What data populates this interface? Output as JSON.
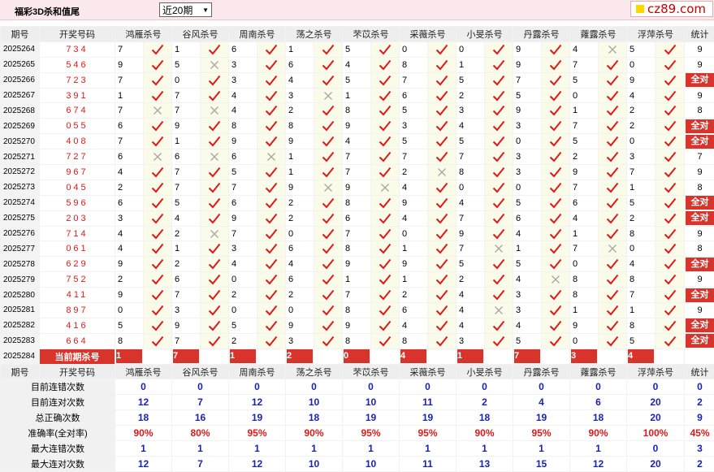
{
  "header": {
    "title": "福彩3D杀和值尾",
    "period_select": "近20期",
    "logo": "cz89.com"
  },
  "columns": [
    "期号",
    "开奖号码",
    "鸿雁杀号",
    "谷风杀号",
    "周南杀号",
    "荡之杀号",
    "芣苡杀号",
    "采薇杀号",
    "小旻杀号",
    "丹露杀号",
    "蕹露杀号",
    "浮萍杀号",
    "统计"
  ],
  "rows": [
    {
      "period": "2025264",
      "draw": "734",
      "nums": [
        "7",
        "1",
        "6",
        "1",
        "5",
        "0",
        "0",
        "9",
        "4",
        "5"
      ],
      "marks": [
        1,
        1,
        1,
        1,
        1,
        1,
        1,
        1,
        0,
        1
      ],
      "total": "9"
    },
    {
      "period": "2025265",
      "draw": "546",
      "nums": [
        "9",
        "5",
        "3",
        "6",
        "4",
        "8",
        "1",
        "9",
        "7",
        "0"
      ],
      "marks": [
        1,
        0,
        1,
        1,
        1,
        1,
        1,
        1,
        1,
        1
      ],
      "total": "9"
    },
    {
      "period": "2025266",
      "draw": "723",
      "nums": [
        "7",
        "0",
        "3",
        "4",
        "5",
        "7",
        "5",
        "7",
        "5",
        "9"
      ],
      "marks": [
        1,
        1,
        1,
        1,
        1,
        1,
        1,
        1,
        1,
        1
      ],
      "total": "全对"
    },
    {
      "period": "2025267",
      "draw": "391",
      "nums": [
        "1",
        "7",
        "4",
        "3",
        "1",
        "6",
        "2",
        "5",
        "0",
        "4"
      ],
      "marks": [
        1,
        1,
        1,
        0,
        1,
        1,
        1,
        1,
        1,
        1
      ],
      "total": "9"
    },
    {
      "period": "2025268",
      "draw": "674",
      "nums": [
        "7",
        "7",
        "4",
        "2",
        "8",
        "5",
        "3",
        "9",
        "1",
        "2"
      ],
      "marks": [
        0,
        0,
        1,
        1,
        1,
        1,
        1,
        1,
        1,
        1
      ],
      "total": "8"
    },
    {
      "period": "2025269",
      "draw": "055",
      "nums": [
        "6",
        "9",
        "8",
        "8",
        "9",
        "3",
        "4",
        "3",
        "7",
        "2"
      ],
      "marks": [
        1,
        1,
        1,
        1,
        1,
        1,
        1,
        1,
        1,
        1
      ],
      "total": "全对"
    },
    {
      "period": "2025270",
      "draw": "408",
      "nums": [
        "7",
        "1",
        "9",
        "9",
        "4",
        "5",
        "5",
        "0",
        "5",
        "0"
      ],
      "marks": [
        1,
        1,
        1,
        1,
        1,
        1,
        1,
        1,
        1,
        1
      ],
      "total": "全对"
    },
    {
      "period": "2025271",
      "draw": "727",
      "nums": [
        "6",
        "6",
        "6",
        "1",
        "7",
        "7",
        "7",
        "3",
        "2",
        "3"
      ],
      "marks": [
        0,
        0,
        0,
        1,
        1,
        1,
        1,
        1,
        1,
        1
      ],
      "total": "7"
    },
    {
      "period": "2025272",
      "draw": "967",
      "nums": [
        "4",
        "7",
        "5",
        "1",
        "7",
        "2",
        "8",
        "3",
        "9",
        "7"
      ],
      "marks": [
        1,
        1,
        1,
        1,
        1,
        0,
        1,
        1,
        1,
        1
      ],
      "total": "9"
    },
    {
      "period": "2025273",
      "draw": "045",
      "nums": [
        "2",
        "7",
        "7",
        "9",
        "9",
        "4",
        "0",
        "0",
        "7",
        "1"
      ],
      "marks": [
        1,
        1,
        1,
        0,
        0,
        1,
        1,
        1,
        1,
        1
      ],
      "total": "8"
    },
    {
      "period": "2025274",
      "draw": "596",
      "nums": [
        "6",
        "5",
        "6",
        "2",
        "8",
        "9",
        "4",
        "5",
        "6",
        "5"
      ],
      "marks": [
        1,
        1,
        1,
        1,
        1,
        1,
        1,
        1,
        1,
        1
      ],
      "total": "全对"
    },
    {
      "period": "2025275",
      "draw": "203",
      "nums": [
        "3",
        "4",
        "9",
        "2",
        "6",
        "4",
        "7",
        "6",
        "4",
        "2"
      ],
      "marks": [
        1,
        1,
        1,
        1,
        1,
        1,
        1,
        1,
        1,
        1
      ],
      "total": "全对"
    },
    {
      "period": "2025276",
      "draw": "714",
      "nums": [
        "4",
        "2",
        "7",
        "0",
        "7",
        "0",
        "9",
        "4",
        "1",
        "8"
      ],
      "marks": [
        1,
        0,
        1,
        1,
        1,
        1,
        1,
        1,
        1,
        1
      ],
      "total": "9"
    },
    {
      "period": "2025277",
      "draw": "061",
      "nums": [
        "4",
        "1",
        "3",
        "6",
        "8",
        "1",
        "7",
        "1",
        "7",
        "0"
      ],
      "marks": [
        1,
        1,
        1,
        1,
        1,
        1,
        0,
        1,
        0,
        1
      ],
      "total": "8"
    },
    {
      "period": "2025278",
      "draw": "629",
      "nums": [
        "9",
        "2",
        "4",
        "4",
        "9",
        "9",
        "5",
        "5",
        "0",
        "4"
      ],
      "marks": [
        1,
        1,
        1,
        1,
        1,
        1,
        1,
        1,
        1,
        1
      ],
      "total": "全对"
    },
    {
      "period": "2025279",
      "draw": "752",
      "nums": [
        "2",
        "6",
        "0",
        "6",
        "1",
        "1",
        "2",
        "4",
        "8",
        "8"
      ],
      "marks": [
        1,
        1,
        1,
        1,
        1,
        1,
        1,
        0,
        1,
        1
      ],
      "total": "9"
    },
    {
      "period": "2025280",
      "draw": "411",
      "nums": [
        "9",
        "7",
        "2",
        "2",
        "7",
        "2",
        "4",
        "3",
        "8",
        "7"
      ],
      "marks": [
        1,
        1,
        1,
        1,
        1,
        1,
        1,
        1,
        1,
        1
      ],
      "total": "全对"
    },
    {
      "period": "2025281",
      "draw": "897",
      "nums": [
        "0",
        "3",
        "0",
        "0",
        "8",
        "6",
        "4",
        "3",
        "1",
        "1"
      ],
      "marks": [
        1,
        1,
        1,
        1,
        1,
        1,
        0,
        1,
        1,
        1
      ],
      "total": "9"
    },
    {
      "period": "2025282",
      "draw": "416",
      "nums": [
        "5",
        "9",
        "5",
        "9",
        "9",
        "4",
        "4",
        "4",
        "9",
        "8"
      ],
      "marks": [
        1,
        1,
        1,
        1,
        1,
        1,
        1,
        1,
        1,
        1
      ],
      "total": "全对"
    },
    {
      "period": "2025283",
      "draw": "664",
      "nums": [
        "8",
        "7",
        "2",
        "3",
        "8",
        "8",
        "3",
        "5",
        "0",
        "5"
      ],
      "marks": [
        1,
        1,
        1,
        1,
        1,
        1,
        1,
        1,
        1,
        1
      ],
      "total": "全对"
    }
  ],
  "current": {
    "period": "2025284",
    "label": "当前期杀号",
    "nums": [
      "1",
      "7",
      "1",
      "2",
      "0",
      "4",
      "1",
      "7",
      "3",
      "4"
    ]
  },
  "stats": [
    {
      "label": "目前连错次数",
      "values": [
        "0",
        "0",
        "0",
        "0",
        "0",
        "0",
        "0",
        "0",
        "0",
        "0",
        "0"
      ]
    },
    {
      "label": "目前连对次数",
      "values": [
        "12",
        "7",
        "12",
        "10",
        "10",
        "11",
        "2",
        "4",
        "6",
        "20",
        "2"
      ]
    },
    {
      "label": "总正确次数",
      "values": [
        "18",
        "16",
        "19",
        "18",
        "19",
        "19",
        "18",
        "19",
        "18",
        "20",
        "9"
      ]
    },
    {
      "label": "准确率(全对率)",
      "values": [
        "90%",
        "80%",
        "95%",
        "90%",
        "95%",
        "95%",
        "90%",
        "95%",
        "90%",
        "100%",
        "45%"
      ],
      "red": true
    },
    {
      "label": "最大连错次数",
      "values": [
        "1",
        "1",
        "1",
        "1",
        "1",
        "1",
        "1",
        "1",
        "1",
        "0",
        "3"
      ]
    },
    {
      "label": "最大连对次数",
      "values": [
        "12",
        "7",
        "12",
        "10",
        "10",
        "11",
        "13",
        "15",
        "12",
        "20",
        "2"
      ]
    }
  ],
  "colors": {
    "red": "#e01818",
    "blue": "#1a22b5",
    "badge": "#d9342b"
  },
  "icons": {
    "correct": "check-icon",
    "wrong": "cross-icon"
  }
}
